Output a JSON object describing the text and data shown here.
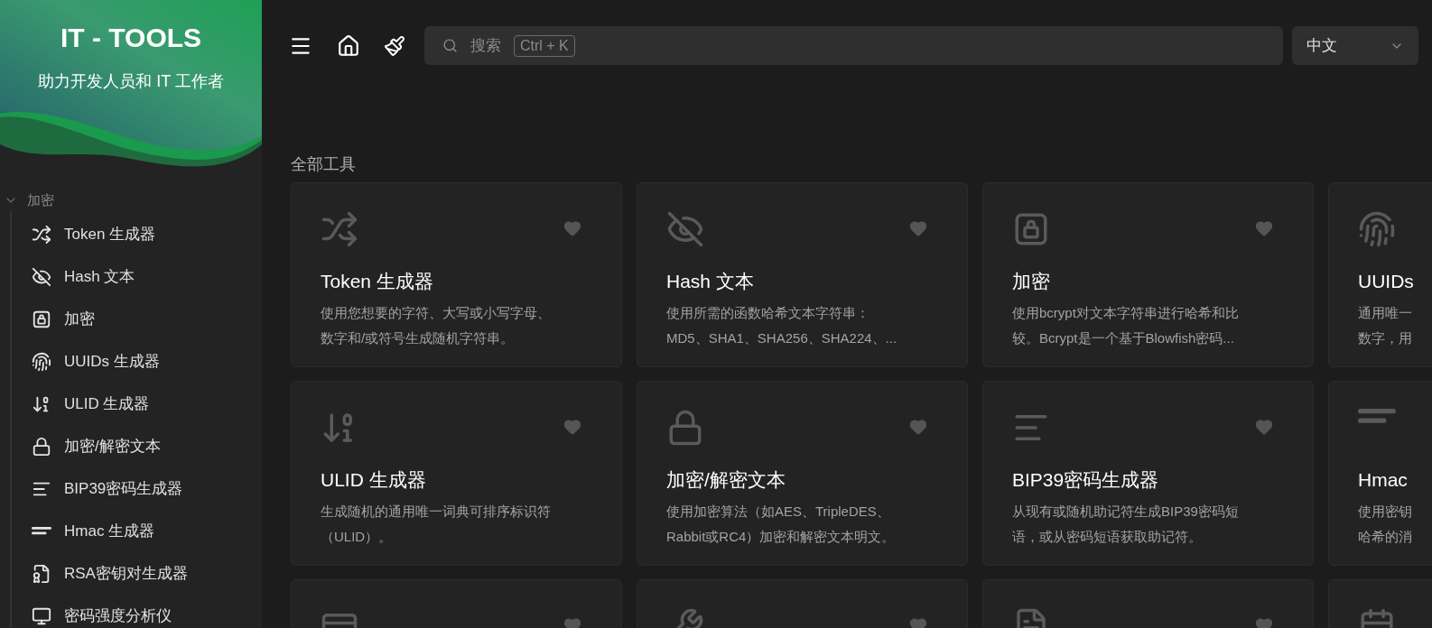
{
  "brand": {
    "title": "IT - TOOLS",
    "subtitle": "助力开发人员和 IT 工作者"
  },
  "sidebar": {
    "category": {
      "label": "加密",
      "expanded": true
    },
    "items": [
      {
        "label": "Token 生成器"
      },
      {
        "label": "Hash 文本"
      },
      {
        "label": "加密"
      },
      {
        "label": "UUIDs 生成器"
      },
      {
        "label": "ULID 生成器"
      },
      {
        "label": "加密/解密文本"
      },
      {
        "label": "BIP39密码生成器"
      },
      {
        "label": "Hmac 生成器"
      },
      {
        "label": "RSA密钥对生成器"
      },
      {
        "label": "密码强度分析仪"
      }
    ]
  },
  "search": {
    "placeholder": "搜索",
    "shortcut": "Ctrl + K"
  },
  "language": {
    "value": "中文"
  },
  "section_title": "全部工具",
  "tools": [
    {
      "title": "Token 生成器",
      "description": [
        "使用您想要的字符、大写或小写字母、",
        "数字和/或符号生成随机字符串。"
      ]
    },
    {
      "title": "Hash 文本",
      "description": [
        "使用所需的函数哈希文本字符串：",
        "MD5、SHA1、SHA256、SHA224、..."
      ]
    },
    {
      "title": "加密",
      "description": [
        "使用bcrypt对文本字符串进行哈希和比",
        "较。Bcrypt是一个基于Blowfish密码..."
      ]
    },
    {
      "title": "UUIDs",
      "description": [
        "通用唯一",
        "数字，用"
      ]
    },
    {
      "title": "ULID 生成器",
      "description": [
        "生成随机的通用唯一词典可排序标识符",
        "（ULID）。"
      ]
    },
    {
      "title": "加密/解密文本",
      "description": [
        "使用加密算法（如AES、TripleDES、",
        "Rabbit或RC4）加密和解密文本明文。"
      ]
    },
    {
      "title": "BIP39密码生成器",
      "description": [
        "从现有或随机助记符生成BIP39密码短",
        "语，或从密码短语获取助记符。"
      ]
    },
    {
      "title": "Hmac",
      "description": [
        "使用密钥",
        "哈希的消"
      ]
    }
  ]
}
